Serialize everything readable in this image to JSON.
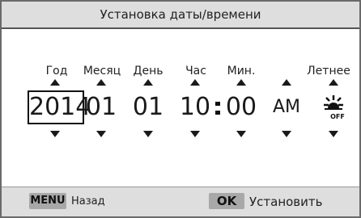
{
  "title": "Установка даты/времени",
  "columns": {
    "year": {
      "label": "Год",
      "value": "2014"
    },
    "month": {
      "label": "Месяц",
      "value": "01"
    },
    "day": {
      "label": "День",
      "value": "01"
    },
    "hour": {
      "label": "Час",
      "value": "10"
    },
    "minute": {
      "label": "Мин.",
      "value": "00"
    },
    "ampm": {
      "label": "",
      "value": "AM"
    },
    "dst": {
      "label": "Летнее",
      "icon": "dst-off-icon",
      "icon_text": "OFF"
    }
  },
  "footer": {
    "back_key": "MENU",
    "back_label": "Назад",
    "ok_key": "OK",
    "ok_label": "Установить"
  }
}
